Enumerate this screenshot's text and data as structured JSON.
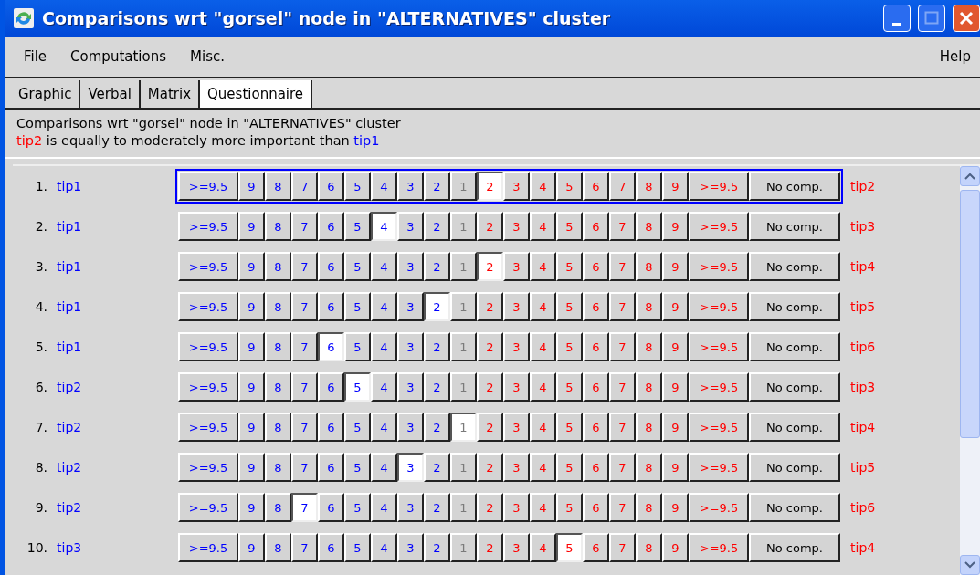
{
  "window": {
    "title": "Comparisons wrt \"gorsel\" node in \"ALTERNATIVES\" cluster"
  },
  "menu": [
    {
      "label": "File"
    },
    {
      "label": "Computations"
    },
    {
      "label": "Misc."
    },
    {
      "label": "Help"
    }
  ],
  "tabs": [
    {
      "label": "Graphic",
      "selected": false
    },
    {
      "label": "Verbal",
      "selected": false
    },
    {
      "label": "Matrix",
      "selected": false
    },
    {
      "label": "Questionnaire",
      "selected": true
    }
  ],
  "info": {
    "heading": "Comparisons wrt \"gorsel\" node in \"ALTERNATIVES\" cluster",
    "winner": "tip2",
    "statement": " is equally to moderately more important than ",
    "loser": "tip1"
  },
  "rows": [
    {
      "number": "1.",
      "left": "tip1",
      "right": "tip2",
      "focused": true,
      "buttons": [
        {
          "label": ">=9.5",
          "kind": "left",
          "selected": false
        },
        {
          "label": "9",
          "kind": "left",
          "selected": false
        },
        {
          "label": "8",
          "kind": "left",
          "selected": false
        },
        {
          "label": "7",
          "kind": "left",
          "selected": false
        },
        {
          "label": "6",
          "kind": "left",
          "selected": false
        },
        {
          "label": "5",
          "kind": "left",
          "selected": false
        },
        {
          "label": "4",
          "kind": "left",
          "selected": false
        },
        {
          "label": "3",
          "kind": "left",
          "selected": false
        },
        {
          "label": "2",
          "kind": "left",
          "selected": false
        },
        {
          "label": "1",
          "kind": "equal",
          "selected": false
        },
        {
          "label": "2",
          "kind": "right",
          "selected": true
        },
        {
          "label": "3",
          "kind": "right",
          "selected": false
        },
        {
          "label": "4",
          "kind": "right",
          "selected": false
        },
        {
          "label": "5",
          "kind": "right",
          "selected": false
        },
        {
          "label": "6",
          "kind": "right",
          "selected": false
        },
        {
          "label": "7",
          "kind": "right",
          "selected": false
        },
        {
          "label": "8",
          "kind": "right",
          "selected": false
        },
        {
          "label": "9",
          "kind": "right",
          "selected": false
        },
        {
          "label": ">=9.5",
          "kind": "right",
          "selected": false
        },
        {
          "label": "No comp.",
          "kind": "none",
          "selected": false
        }
      ]
    },
    {
      "number": "2.",
      "left": "tip1",
      "right": "tip3",
      "focused": false,
      "buttons": [
        {
          "label": ">=9.5",
          "kind": "left",
          "selected": false
        },
        {
          "label": "9",
          "kind": "left",
          "selected": false
        },
        {
          "label": "8",
          "kind": "left",
          "selected": false
        },
        {
          "label": "7",
          "kind": "left",
          "selected": false
        },
        {
          "label": "6",
          "kind": "left",
          "selected": false
        },
        {
          "label": "5",
          "kind": "left",
          "selected": false
        },
        {
          "label": "4",
          "kind": "left",
          "selected": true
        },
        {
          "label": "3",
          "kind": "left",
          "selected": false
        },
        {
          "label": "2",
          "kind": "left",
          "selected": false
        },
        {
          "label": "1",
          "kind": "equal",
          "selected": false
        },
        {
          "label": "2",
          "kind": "right",
          "selected": false
        },
        {
          "label": "3",
          "kind": "right",
          "selected": false
        },
        {
          "label": "4",
          "kind": "right",
          "selected": false
        },
        {
          "label": "5",
          "kind": "right",
          "selected": false
        },
        {
          "label": "6",
          "kind": "right",
          "selected": false
        },
        {
          "label": "7",
          "kind": "right",
          "selected": false
        },
        {
          "label": "8",
          "kind": "right",
          "selected": false
        },
        {
          "label": "9",
          "kind": "right",
          "selected": false
        },
        {
          "label": ">=9.5",
          "kind": "right",
          "selected": false
        },
        {
          "label": "No comp.",
          "kind": "none",
          "selected": false
        }
      ]
    },
    {
      "number": "3.",
      "left": "tip1",
      "right": "tip4",
      "focused": false,
      "buttons": [
        {
          "label": ">=9.5",
          "kind": "left",
          "selected": false
        },
        {
          "label": "9",
          "kind": "left",
          "selected": false
        },
        {
          "label": "8",
          "kind": "left",
          "selected": false
        },
        {
          "label": "7",
          "kind": "left",
          "selected": false
        },
        {
          "label": "6",
          "kind": "left",
          "selected": false
        },
        {
          "label": "5",
          "kind": "left",
          "selected": false
        },
        {
          "label": "4",
          "kind": "left",
          "selected": false
        },
        {
          "label": "3",
          "kind": "left",
          "selected": false
        },
        {
          "label": "2",
          "kind": "left",
          "selected": false
        },
        {
          "label": "1",
          "kind": "equal",
          "selected": false
        },
        {
          "label": "2",
          "kind": "right",
          "selected": true
        },
        {
          "label": "3",
          "kind": "right",
          "selected": false
        },
        {
          "label": "4",
          "kind": "right",
          "selected": false
        },
        {
          "label": "5",
          "kind": "right",
          "selected": false
        },
        {
          "label": "6",
          "kind": "right",
          "selected": false
        },
        {
          "label": "7",
          "kind": "right",
          "selected": false
        },
        {
          "label": "8",
          "kind": "right",
          "selected": false
        },
        {
          "label": "9",
          "kind": "right",
          "selected": false
        },
        {
          "label": ">=9.5",
          "kind": "right",
          "selected": false
        },
        {
          "label": "No comp.",
          "kind": "none",
          "selected": false
        }
      ]
    },
    {
      "number": "4.",
      "left": "tip1",
      "right": "tip5",
      "focused": false,
      "buttons": [
        {
          "label": ">=9.5",
          "kind": "left",
          "selected": false
        },
        {
          "label": "9",
          "kind": "left",
          "selected": false
        },
        {
          "label": "8",
          "kind": "left",
          "selected": false
        },
        {
          "label": "7",
          "kind": "left",
          "selected": false
        },
        {
          "label": "6",
          "kind": "left",
          "selected": false
        },
        {
          "label": "5",
          "kind": "left",
          "selected": false
        },
        {
          "label": "4",
          "kind": "left",
          "selected": false
        },
        {
          "label": "3",
          "kind": "left",
          "selected": false
        },
        {
          "label": "2",
          "kind": "left",
          "selected": true
        },
        {
          "label": "1",
          "kind": "equal",
          "selected": false
        },
        {
          "label": "2",
          "kind": "right",
          "selected": false
        },
        {
          "label": "3",
          "kind": "right",
          "selected": false
        },
        {
          "label": "4",
          "kind": "right",
          "selected": false
        },
        {
          "label": "5",
          "kind": "right",
          "selected": false
        },
        {
          "label": "6",
          "kind": "right",
          "selected": false
        },
        {
          "label": "7",
          "kind": "right",
          "selected": false
        },
        {
          "label": "8",
          "kind": "right",
          "selected": false
        },
        {
          "label": "9",
          "kind": "right",
          "selected": false
        },
        {
          "label": ">=9.5",
          "kind": "right",
          "selected": false
        },
        {
          "label": "No comp.",
          "kind": "none",
          "selected": false
        }
      ]
    },
    {
      "number": "5.",
      "left": "tip1",
      "right": "tip6",
      "focused": false,
      "buttons": [
        {
          "label": ">=9.5",
          "kind": "left",
          "selected": false
        },
        {
          "label": "9",
          "kind": "left",
          "selected": false
        },
        {
          "label": "8",
          "kind": "left",
          "selected": false
        },
        {
          "label": "7",
          "kind": "left",
          "selected": false
        },
        {
          "label": "6",
          "kind": "left",
          "selected": true
        },
        {
          "label": "5",
          "kind": "left",
          "selected": false
        },
        {
          "label": "4",
          "kind": "left",
          "selected": false
        },
        {
          "label": "3",
          "kind": "left",
          "selected": false
        },
        {
          "label": "2",
          "kind": "left",
          "selected": false
        },
        {
          "label": "1",
          "kind": "equal",
          "selected": false
        },
        {
          "label": "2",
          "kind": "right",
          "selected": false
        },
        {
          "label": "3",
          "kind": "right",
          "selected": false
        },
        {
          "label": "4",
          "kind": "right",
          "selected": false
        },
        {
          "label": "5",
          "kind": "right",
          "selected": false
        },
        {
          "label": "6",
          "kind": "right",
          "selected": false
        },
        {
          "label": "7",
          "kind": "right",
          "selected": false
        },
        {
          "label": "8",
          "kind": "right",
          "selected": false
        },
        {
          "label": "9",
          "kind": "right",
          "selected": false
        },
        {
          "label": ">=9.5",
          "kind": "right",
          "selected": false
        },
        {
          "label": "No comp.",
          "kind": "none",
          "selected": false
        }
      ]
    },
    {
      "number": "6.",
      "left": "tip2",
      "right": "tip3",
      "focused": false,
      "buttons": [
        {
          "label": ">=9.5",
          "kind": "left",
          "selected": false
        },
        {
          "label": "9",
          "kind": "left",
          "selected": false
        },
        {
          "label": "8",
          "kind": "left",
          "selected": false
        },
        {
          "label": "7",
          "kind": "left",
          "selected": false
        },
        {
          "label": "6",
          "kind": "left",
          "selected": false
        },
        {
          "label": "5",
          "kind": "left",
          "selected": true
        },
        {
          "label": "4",
          "kind": "left",
          "selected": false
        },
        {
          "label": "3",
          "kind": "left",
          "selected": false
        },
        {
          "label": "2",
          "kind": "left",
          "selected": false
        },
        {
          "label": "1",
          "kind": "equal",
          "selected": false
        },
        {
          "label": "2",
          "kind": "right",
          "selected": false
        },
        {
          "label": "3",
          "kind": "right",
          "selected": false
        },
        {
          "label": "4",
          "kind": "right",
          "selected": false
        },
        {
          "label": "5",
          "kind": "right",
          "selected": false
        },
        {
          "label": "6",
          "kind": "right",
          "selected": false
        },
        {
          "label": "7",
          "kind": "right",
          "selected": false
        },
        {
          "label": "8",
          "kind": "right",
          "selected": false
        },
        {
          "label": "9",
          "kind": "right",
          "selected": false
        },
        {
          "label": ">=9.5",
          "kind": "right",
          "selected": false
        },
        {
          "label": "No comp.",
          "kind": "none",
          "selected": false
        }
      ]
    },
    {
      "number": "7.",
      "left": "tip2",
      "right": "tip4",
      "focused": false,
      "buttons": [
        {
          "label": ">=9.5",
          "kind": "left",
          "selected": false
        },
        {
          "label": "9",
          "kind": "left",
          "selected": false
        },
        {
          "label": "8",
          "kind": "left",
          "selected": false
        },
        {
          "label": "7",
          "kind": "left",
          "selected": false
        },
        {
          "label": "6",
          "kind": "left",
          "selected": false
        },
        {
          "label": "5",
          "kind": "left",
          "selected": false
        },
        {
          "label": "4",
          "kind": "left",
          "selected": false
        },
        {
          "label": "3",
          "kind": "left",
          "selected": false
        },
        {
          "label": "2",
          "kind": "left",
          "selected": false
        },
        {
          "label": "1",
          "kind": "equal",
          "selected": true
        },
        {
          "label": "2",
          "kind": "right",
          "selected": false
        },
        {
          "label": "3",
          "kind": "right",
          "selected": false
        },
        {
          "label": "4",
          "kind": "right",
          "selected": false
        },
        {
          "label": "5",
          "kind": "right",
          "selected": false
        },
        {
          "label": "6",
          "kind": "right",
          "selected": false
        },
        {
          "label": "7",
          "kind": "right",
          "selected": false
        },
        {
          "label": "8",
          "kind": "right",
          "selected": false
        },
        {
          "label": "9",
          "kind": "right",
          "selected": false
        },
        {
          "label": ">=9.5",
          "kind": "right",
          "selected": false
        },
        {
          "label": "No comp.",
          "kind": "none",
          "selected": false
        }
      ]
    },
    {
      "number": "8.",
      "left": "tip2",
      "right": "tip5",
      "focused": false,
      "buttons": [
        {
          "label": ">=9.5",
          "kind": "left",
          "selected": false
        },
        {
          "label": "9",
          "kind": "left",
          "selected": false
        },
        {
          "label": "8",
          "kind": "left",
          "selected": false
        },
        {
          "label": "7",
          "kind": "left",
          "selected": false
        },
        {
          "label": "6",
          "kind": "left",
          "selected": false
        },
        {
          "label": "5",
          "kind": "left",
          "selected": false
        },
        {
          "label": "4",
          "kind": "left",
          "selected": false
        },
        {
          "label": "3",
          "kind": "left",
          "selected": true
        },
        {
          "label": "2",
          "kind": "left",
          "selected": false
        },
        {
          "label": "1",
          "kind": "equal",
          "selected": false
        },
        {
          "label": "2",
          "kind": "right",
          "selected": false
        },
        {
          "label": "3",
          "kind": "right",
          "selected": false
        },
        {
          "label": "4",
          "kind": "right",
          "selected": false
        },
        {
          "label": "5",
          "kind": "right",
          "selected": false
        },
        {
          "label": "6",
          "kind": "right",
          "selected": false
        },
        {
          "label": "7",
          "kind": "right",
          "selected": false
        },
        {
          "label": "8",
          "kind": "right",
          "selected": false
        },
        {
          "label": "9",
          "kind": "right",
          "selected": false
        },
        {
          "label": ">=9.5",
          "kind": "right",
          "selected": false
        },
        {
          "label": "No comp.",
          "kind": "none",
          "selected": false
        }
      ]
    },
    {
      "number": "9.",
      "left": "tip2",
      "right": "tip6",
      "focused": false,
      "buttons": [
        {
          "label": ">=9.5",
          "kind": "left",
          "selected": false
        },
        {
          "label": "9",
          "kind": "left",
          "selected": false
        },
        {
          "label": "8",
          "kind": "left",
          "selected": false
        },
        {
          "label": "7",
          "kind": "left",
          "selected": true
        },
        {
          "label": "6",
          "kind": "left",
          "selected": false
        },
        {
          "label": "5",
          "kind": "left",
          "selected": false
        },
        {
          "label": "4",
          "kind": "left",
          "selected": false
        },
        {
          "label": "3",
          "kind": "left",
          "selected": false
        },
        {
          "label": "2",
          "kind": "left",
          "selected": false
        },
        {
          "label": "1",
          "kind": "equal",
          "selected": false
        },
        {
          "label": "2",
          "kind": "right",
          "selected": false
        },
        {
          "label": "3",
          "kind": "right",
          "selected": false
        },
        {
          "label": "4",
          "kind": "right",
          "selected": false
        },
        {
          "label": "5",
          "kind": "right",
          "selected": false
        },
        {
          "label": "6",
          "kind": "right",
          "selected": false
        },
        {
          "label": "7",
          "kind": "right",
          "selected": false
        },
        {
          "label": "8",
          "kind": "right",
          "selected": false
        },
        {
          "label": "9",
          "kind": "right",
          "selected": false
        },
        {
          "label": ">=9.5",
          "kind": "right",
          "selected": false
        },
        {
          "label": "No comp.",
          "kind": "none",
          "selected": false
        }
      ]
    },
    {
      "number": "10.",
      "left": "tip3",
      "right": "tip4",
      "focused": false,
      "buttons": [
        {
          "label": ">=9.5",
          "kind": "left",
          "selected": false
        },
        {
          "label": "9",
          "kind": "left",
          "selected": false
        },
        {
          "label": "8",
          "kind": "left",
          "selected": false
        },
        {
          "label": "7",
          "kind": "left",
          "selected": false
        },
        {
          "label": "6",
          "kind": "left",
          "selected": false
        },
        {
          "label": "5",
          "kind": "left",
          "selected": false
        },
        {
          "label": "4",
          "kind": "left",
          "selected": false
        },
        {
          "label": "3",
          "kind": "left",
          "selected": false
        },
        {
          "label": "2",
          "kind": "left",
          "selected": false
        },
        {
          "label": "1",
          "kind": "equal",
          "selected": false
        },
        {
          "label": "2",
          "kind": "right",
          "selected": false
        },
        {
          "label": "3",
          "kind": "right",
          "selected": false
        },
        {
          "label": "4",
          "kind": "right",
          "selected": false
        },
        {
          "label": "5",
          "kind": "right",
          "selected": true
        },
        {
          "label": "6",
          "kind": "right",
          "selected": false
        },
        {
          "label": "7",
          "kind": "right",
          "selected": false
        },
        {
          "label": "8",
          "kind": "right",
          "selected": false
        },
        {
          "label": "9",
          "kind": "right",
          "selected": false
        },
        {
          "label": ">=9.5",
          "kind": "right",
          "selected": false
        },
        {
          "label": "No comp.",
          "kind": "none",
          "selected": false
        }
      ]
    }
  ]
}
